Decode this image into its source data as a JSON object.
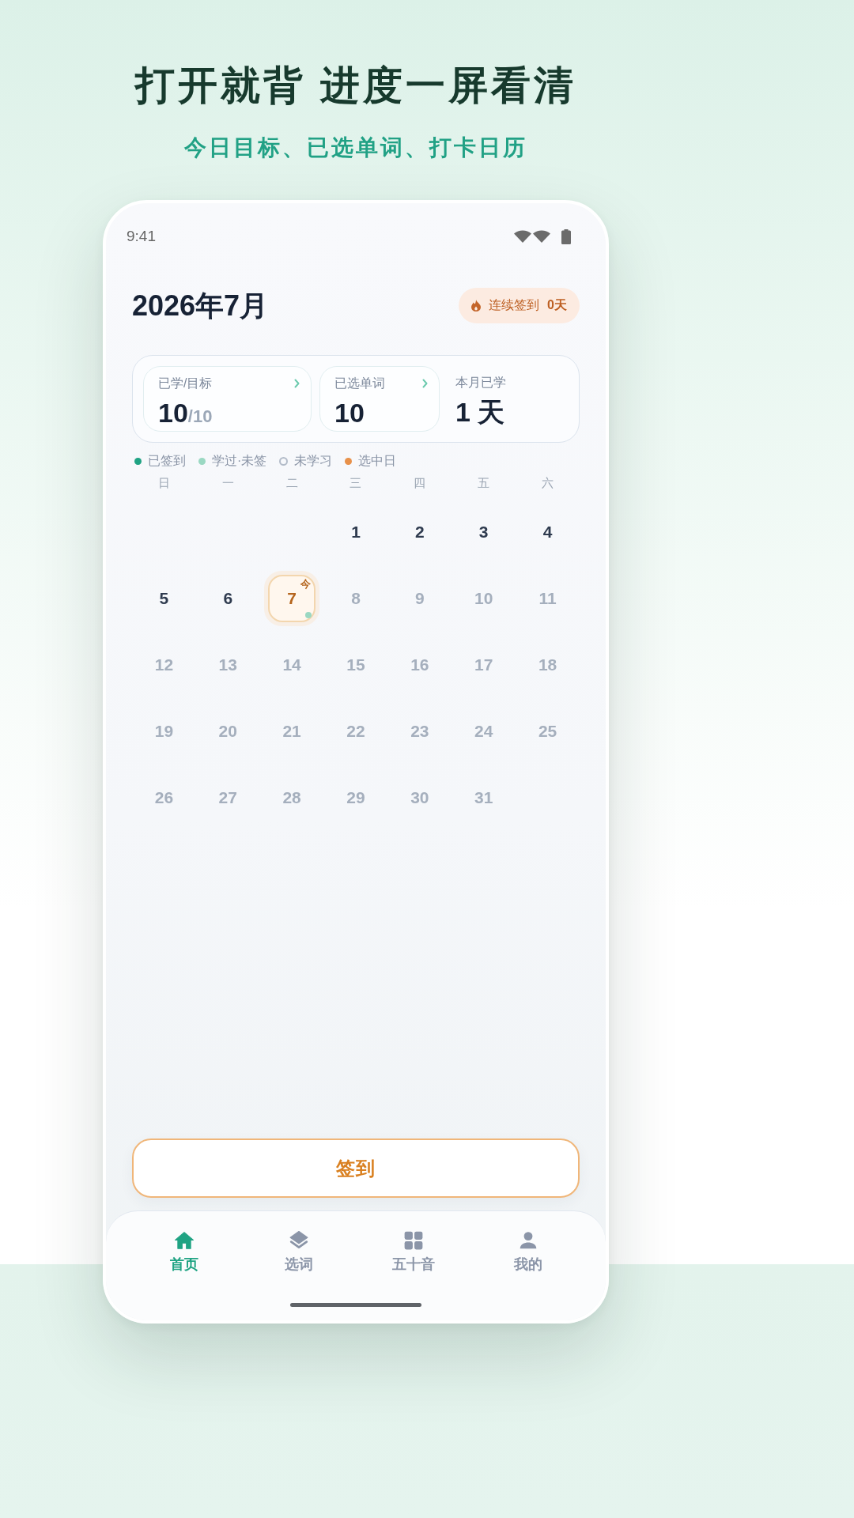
{
  "headline": {
    "title": "打开就背 进度一屏看清",
    "subtitle": "今日目标、已选单词、打卡日历"
  },
  "status_bar": {
    "time": "9:41"
  },
  "header": {
    "month": "2026年7月",
    "streak": {
      "label": "连续签到",
      "value": "0天"
    }
  },
  "stats": [
    {
      "kind": "card",
      "label": "已学/目标",
      "value": "10",
      "total": "/10"
    },
    {
      "kind": "card",
      "label": "已选单词",
      "value": "10"
    },
    {
      "kind": "plain",
      "label": "本月已学",
      "value": "1 天"
    }
  ],
  "legend": [
    {
      "kind": "dot",
      "label": "已签到",
      "color": "#1fa383"
    },
    {
      "kind": "dot",
      "label": "学过·未签",
      "color": "#9ad8c2"
    },
    {
      "kind": "ring",
      "label": "未学习",
      "color": "#b3bcc9"
    },
    {
      "kind": "dot",
      "label": "选中日",
      "color": "#e8914a"
    }
  ],
  "weekdays": [
    "日",
    "一",
    "二",
    "三",
    "四",
    "五",
    "六"
  ],
  "weeks": [
    [
      {
        "kind": "blank"
      },
      {
        "kind": "blank"
      },
      {
        "kind": "blank"
      },
      {
        "kind": "day",
        "day": "1",
        "future": false,
        "studied": false,
        "selected": false
      },
      {
        "kind": "day",
        "day": "2",
        "future": false,
        "studied": false,
        "selected": false
      },
      {
        "kind": "day",
        "day": "3",
        "future": false,
        "studied": false,
        "selected": false
      },
      {
        "kind": "day",
        "day": "4",
        "future": false,
        "studied": false,
        "selected": false
      }
    ],
    [
      {
        "kind": "day",
        "day": "5",
        "future": false,
        "studied": false,
        "selected": false
      },
      {
        "kind": "day",
        "day": "6",
        "future": false,
        "studied": false,
        "selected": false
      },
      {
        "kind": "day",
        "day": "7",
        "future": false,
        "studied": true,
        "selected": true,
        "badge": "今"
      },
      {
        "kind": "day",
        "day": "8",
        "future": true,
        "studied": false,
        "selected": false
      },
      {
        "kind": "day",
        "day": "9",
        "future": true,
        "studied": false,
        "selected": false
      },
      {
        "kind": "day",
        "day": "10",
        "future": true,
        "studied": false,
        "selected": false
      },
      {
        "kind": "day",
        "day": "11",
        "future": true,
        "studied": false,
        "selected": false
      }
    ],
    [
      {
        "kind": "day",
        "day": "12",
        "future": true,
        "studied": false,
        "selected": false
      },
      {
        "kind": "day",
        "day": "13",
        "future": true,
        "studied": false,
        "selected": false
      },
      {
        "kind": "day",
        "day": "14",
        "future": true,
        "studied": false,
        "selected": false
      },
      {
        "kind": "day",
        "day": "15",
        "future": true,
        "studied": false,
        "selected": false
      },
      {
        "kind": "day",
        "day": "16",
        "future": true,
        "studied": false,
        "selected": false
      },
      {
        "kind": "day",
        "day": "17",
        "future": true,
        "studied": false,
        "selected": false
      },
      {
        "kind": "day",
        "day": "18",
        "future": true,
        "studied": false,
        "selected": false
      }
    ],
    [
      {
        "kind": "day",
        "day": "19",
        "future": true,
        "studied": false,
        "selected": false
      },
      {
        "kind": "day",
        "day": "20",
        "future": true,
        "studied": false,
        "selected": false
      },
      {
        "kind": "day",
        "day": "21",
        "future": true,
        "studied": false,
        "selected": false
      },
      {
        "kind": "day",
        "day": "22",
        "future": true,
        "studied": false,
        "selected": false
      },
      {
        "kind": "day",
        "day": "23",
        "future": true,
        "studied": false,
        "selected": false
      },
      {
        "kind": "day",
        "day": "24",
        "future": true,
        "studied": false,
        "selected": false
      },
      {
        "kind": "day",
        "day": "25",
        "future": true,
        "studied": false,
        "selected": false
      }
    ],
    [
      {
        "kind": "day",
        "day": "26",
        "future": true,
        "studied": false,
        "selected": false
      },
      {
        "kind": "day",
        "day": "27",
        "future": true,
        "studied": false,
        "selected": false
      },
      {
        "kind": "day",
        "day": "28",
        "future": true,
        "studied": false,
        "selected": false
      },
      {
        "kind": "day",
        "day": "29",
        "future": true,
        "studied": false,
        "selected": false
      },
      {
        "kind": "day",
        "day": "30",
        "future": true,
        "studied": false,
        "selected": false
      },
      {
        "kind": "day",
        "day": "31",
        "future": true,
        "studied": false,
        "selected": false
      },
      {
        "kind": "blank"
      }
    ]
  ],
  "checkin_button": "签到",
  "nav": [
    {
      "kind": "home",
      "label": "首页",
      "selected": true
    },
    {
      "kind": "layers",
      "label": "选词",
      "selected": false
    },
    {
      "kind": "grid",
      "label": "五十音",
      "selected": false
    },
    {
      "kind": "person",
      "label": "我的",
      "selected": false
    }
  ]
}
